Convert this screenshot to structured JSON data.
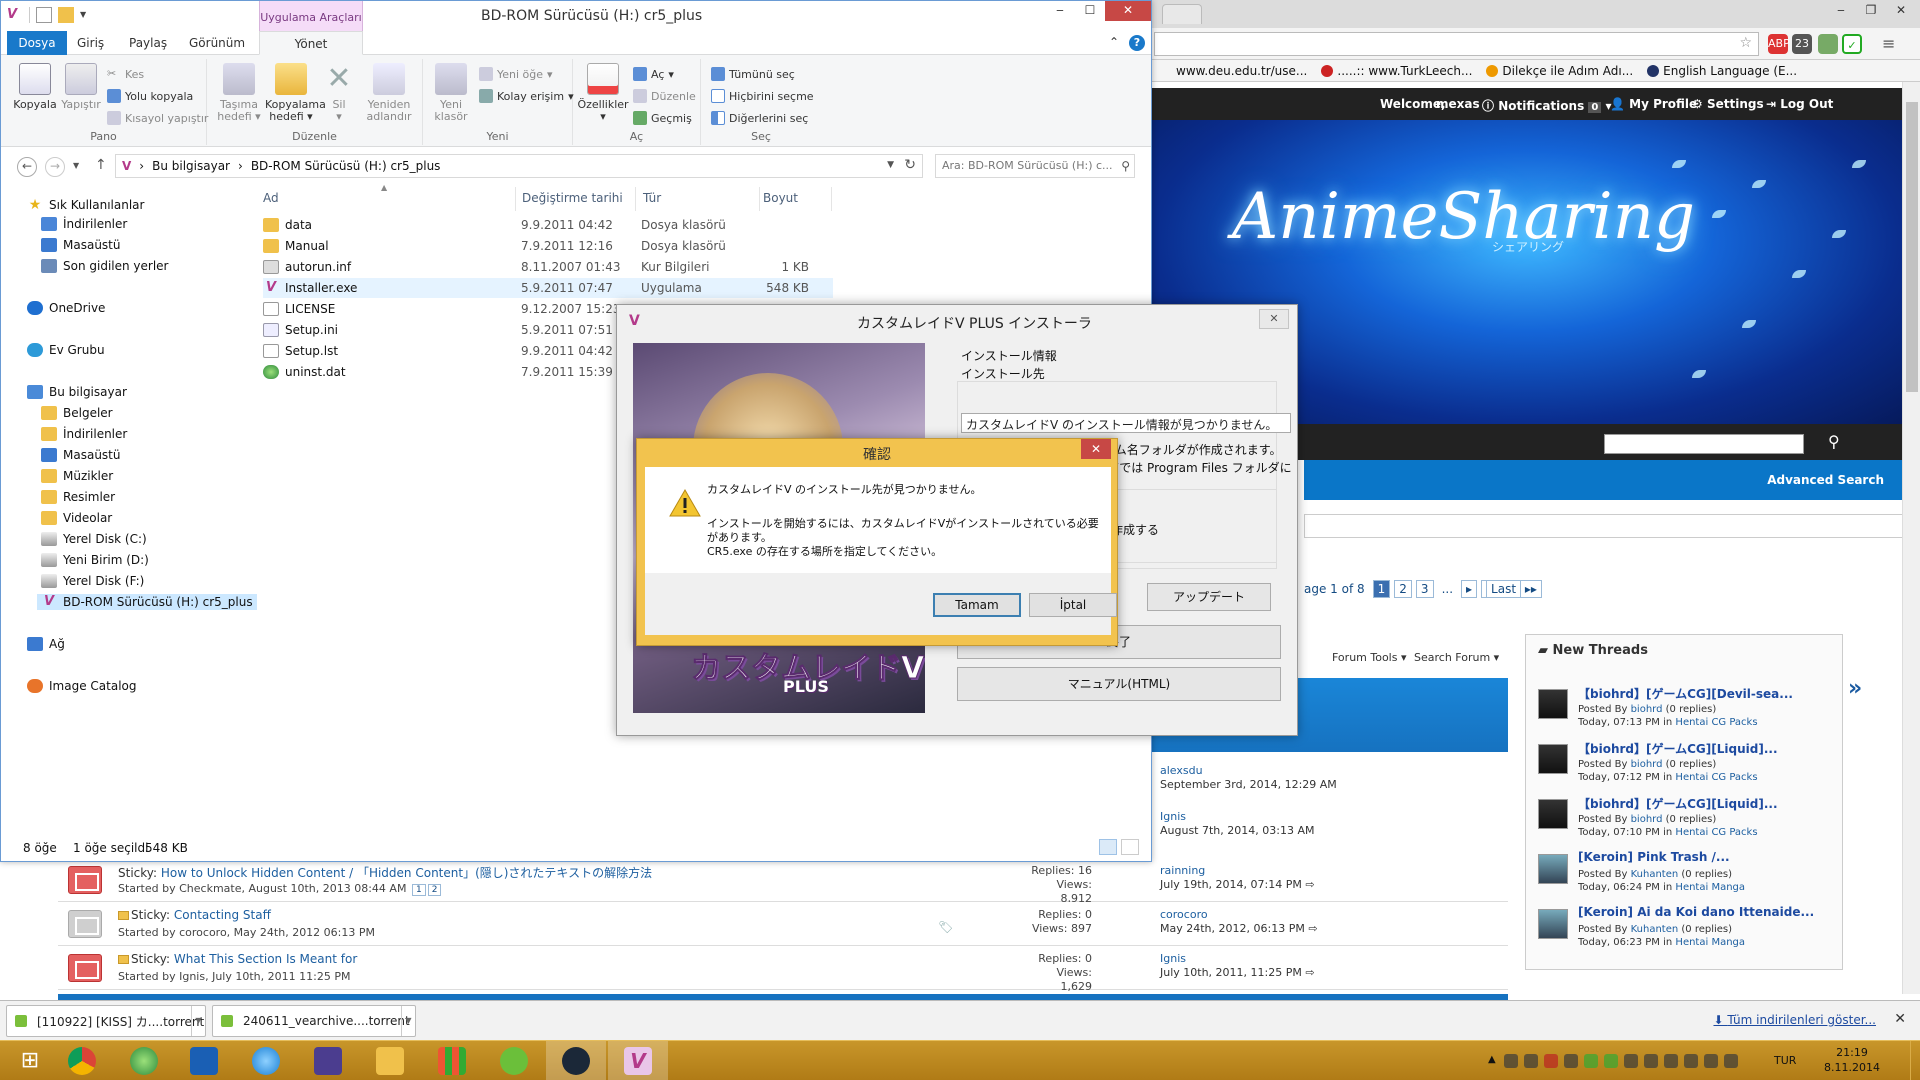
{
  "browser": {
    "bookmarks": [
      "www.deu.edu.tr/use...",
      ".....:: www.TurkLeech...",
      "Dilekçe ile Adım Adı...",
      "English Language (E..."
    ],
    "ext_badge": "23",
    "userbar": {
      "welcome": "Welcome,",
      "username": "mexas",
      "notifications": "Notifications",
      "notif_count": "0",
      "profile": "My Profile",
      "settings": "Settings",
      "logout": "Log Out"
    },
    "site_logo": "AnimeSharing",
    "site_logo_kana": "シェアリング",
    "advanced_search": "Advanced Search",
    "pager": {
      "label": "age 1 of 8",
      "pages": [
        "1",
        "2",
        "3",
        "..."
      ],
      "last": "Last"
    },
    "forum_tools": "Forum Tools",
    "search_forum": "Search Forum",
    "last_posts": [
      {
        "user": "alexsdu",
        "time": "September 3rd, 2014, 12:29 AM"
      },
      {
        "user": "Ignis",
        "time": "August 7th, 2014, 03:13 AM"
      }
    ],
    "new_threads": {
      "heading": "New Threads",
      "items": [
        {
          "title": "【biohrd】[ゲームCG][Devil-sea...",
          "posted_by": "Posted By",
          "author": "biohrd",
          "replies": "(0 replies)",
          "time": "Today, 07:13 PM in",
          "forum": "Hentai CG Packs"
        },
        {
          "title": "【biohrd】[ゲームCG][Liquid]...",
          "posted_by": "Posted By",
          "author": "biohrd",
          "replies": "(0 replies)",
          "time": "Today, 07:12 PM in",
          "forum": "Hentai CG Packs"
        },
        {
          "title": "【biohrd】[ゲームCG][Liquid]...",
          "posted_by": "Posted By",
          "author": "biohrd",
          "replies": "(0 replies)",
          "time": "Today, 07:10 PM in",
          "forum": "Hentai CG Packs"
        },
        {
          "title": "[Keroin] Pink Trash /...",
          "posted_by": "Posted By",
          "author": "Kuhanten",
          "replies": "(0 replies)",
          "time": "Today, 06:24 PM in",
          "forum": "Hentai Manga"
        },
        {
          "title": "[Keroin] Ai da Koi dano Ittenaide...",
          "posted_by": "Posted By",
          "author": "Kuhanten",
          "replies": "(0 replies)",
          "time": "Today, 06:23 PM in",
          "forum": "Hentai Manga"
        }
      ]
    },
    "threads": [
      {
        "prefix": "Sticky:",
        "title": "How to Unlock Hidden Content / 「Hidden Content」(隠し)されたテキストの解除方法",
        "by": "Started by Checkmate, August 10th, 2013 08:44 AM",
        "pages": [
          "1",
          "2"
        ],
        "replies": "Replies: 16",
        "views": "Views: 8,912",
        "lp_user": "rainning",
        "lp_time": "July 19th, 2014, 07:14 PM"
      },
      {
        "prefix": "Sticky:",
        "title": "Contacting Staff",
        "by": "Started by corocoro, May 24th, 2012 06:13 PM",
        "pages": [],
        "replies": "Replies: 0",
        "views": "Views: 897",
        "lp_user": "corocoro",
        "lp_time": "May 24th, 2012, 06:13 PM"
      },
      {
        "prefix": "Sticky:",
        "title": "What This Section Is Meant for",
        "by": "Started by Ignis, July 10th, 2011 11:25 PM",
        "pages": [],
        "replies": "Replies: 0",
        "views": "Views: 1,629",
        "lp_user": "Ignis",
        "lp_time": "July 10th, 2011, 11:25 PM"
      }
    ]
  },
  "downloads": {
    "items": [
      "[110922] [KISS] カ....torrent",
      "240611_vearchive....torrent"
    ],
    "show_all": "Tüm indirilenleri göster..."
  },
  "taskbar": {
    "lang": "TUR",
    "time": "21:19",
    "date": "8.11.2014"
  },
  "explorer": {
    "context_tab": "Uygulama Araçları",
    "title": "BD-ROM Sürücüsü (H:) cr5_plus",
    "tabs": [
      "Dosya",
      "Giriş",
      "Paylaş",
      "Görünüm",
      "Yönet"
    ],
    "ribbon": {
      "copy": "Kopyala",
      "paste": "Yapıştır",
      "cut": "Kes",
      "copy_path": "Yolu kopyala",
      "paste_shortcut": "Kısayol yapıştır",
      "group_clipboard": "Pano",
      "move_to": "Taşıma hedefi",
      "copy_to": "Kopyalama hedefi",
      "delete": "Sil",
      "rename": "Yeniden adlandır",
      "group_organize": "Düzenle",
      "new_folder": "Yeni klasör",
      "new_item": "Yeni öğe",
      "easy_access": "Kolay erişim",
      "group_new": "Yeni",
      "properties": "Özellikler",
      "open": "Aç",
      "edit": "Düzenle",
      "history": "Geçmiş",
      "group_open": "Aç",
      "select_all": "Tümünü seç",
      "select_none": "Hiçbirini seçme",
      "invert": "Diğerlerini seç",
      "group_select": "Seç"
    },
    "breadcrumb": [
      "Bu bilgisayar",
      "BD-ROM Sürücüsü (H:) cr5_plus"
    ],
    "search_placeholder": "Ara: BD-ROM Sürücüsü (H:) c...",
    "nav": {
      "favorites": "Sık Kullanılanlar",
      "fav_items": [
        "İndirilenler",
        "Masaüstü",
        "Son gidilen yerler"
      ],
      "onedrive": "OneDrive",
      "homegroup": "Ev Grubu",
      "thispc": "Bu bilgisayar",
      "pc_items": [
        "Belgeler",
        "İndirilenler",
        "Masaüstü",
        "Müzikler",
        "Resimler",
        "Videolar",
        "Yerel Disk (C:)",
        "Yeni Birim (D:)",
        "Yerel Disk (F:)",
        "BD-ROM Sürücüsü (H:) cr5_plus"
      ],
      "network": "Ağ",
      "image_catalog": "Image Catalog"
    },
    "columns": {
      "name": "Ad",
      "date": "Değiştirme tarihi",
      "type": "Tür",
      "size": "Boyut"
    },
    "files": [
      {
        "name": "data",
        "date": "9.9.2011 04:42",
        "type": "Dosya klasörü",
        "size": ""
      },
      {
        "name": "Manual",
        "date": "7.9.2011 12:16",
        "type": "Dosya klasörü",
        "size": ""
      },
      {
        "name": "autorun.inf",
        "date": "8.11.2007 01:43",
        "type": "Kur Bilgileri",
        "size": "1 KB"
      },
      {
        "name": "Installer.exe",
        "date": "5.9.2011 07:47",
        "type": "Uygulama",
        "size": "548 KB"
      },
      {
        "name": "LICENSE",
        "date": "9.12.2007 15:23",
        "type": "",
        "size": ""
      },
      {
        "name": "Setup.ini",
        "date": "5.9.2011 07:51",
        "type": "",
        "size": ""
      },
      {
        "name": "Setup.lst",
        "date": "9.9.2011 04:42",
        "type": "",
        "size": ""
      },
      {
        "name": "uninst.dat",
        "date": "7.9.2011 15:39",
        "type": "",
        "size": ""
      }
    ],
    "status": {
      "count": "8 öğe",
      "selected": "1 öğe seçildi",
      "size": "548 KB"
    }
  },
  "installer": {
    "title": "カスタムレイドV PLUS インストーラ",
    "logo": "カスタムレイドV",
    "logo_plus": "PLUS",
    "info_label": "インストール情報",
    "dest_label": "インストール先",
    "dest_value": "カスタムレイドV のインストール情報が見つかりません。",
    "note1": "※選択したフォルダ内にゲーム名フォルダが作成されます。",
    "note2": "※WindowsVista,Windows7では Program Files フォルダに",
    "create_option": "を作成する",
    "option_frag": "る",
    "update_btn": "アップデート",
    "exit_btn": "終了",
    "manual_btn": "マニュアル(HTML)"
  },
  "dialog": {
    "title": "確認",
    "line1": "カスタムレイドV のインストール先が見つかりません。",
    "line2": "インストールを開始するには、カスタムレイドVがインストールされている必要",
    "line3": "があります。",
    "line4": "CR5.exe の存在する場所を指定してください。",
    "ok": "Tamam",
    "cancel": "İptal"
  }
}
